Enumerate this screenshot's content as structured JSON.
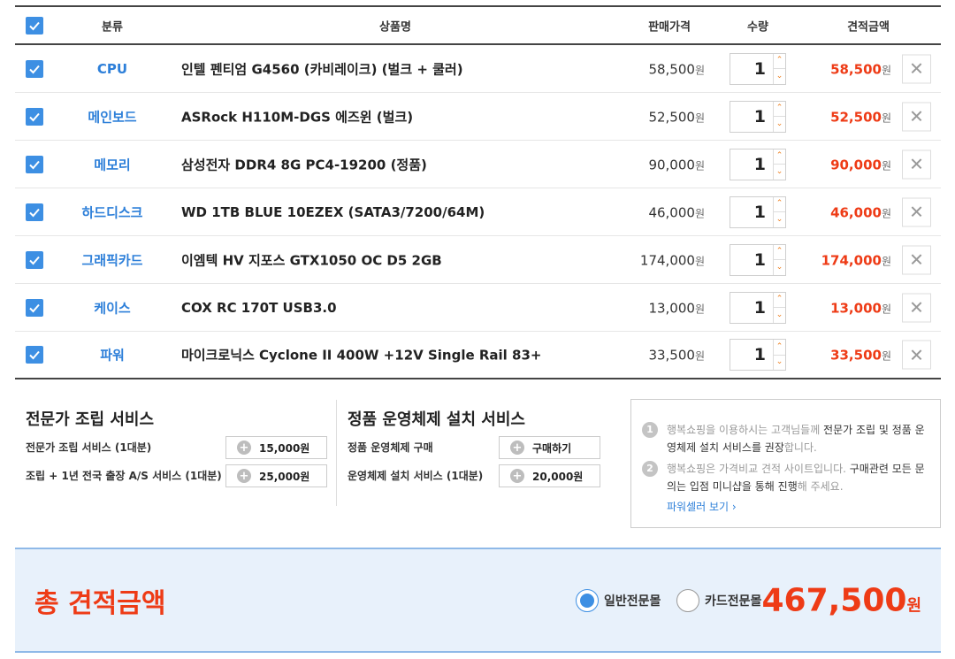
{
  "header": {
    "category": "분류",
    "product": "상품명",
    "price": "판매가격",
    "qty": "수량",
    "total": "견적금액"
  },
  "currency": "원",
  "items": [
    {
      "category": "CPU",
      "name": "인텔 펜티엄 G4560 (카비레이크) (벌크 + 쿨러)",
      "price": "58,500",
      "qty": "1",
      "total": "58,500"
    },
    {
      "category": "메인보드",
      "name": "ASRock H110M-DGS 에즈윈 (벌크)",
      "price": "52,500",
      "qty": "1",
      "total": "52,500"
    },
    {
      "category": "메모리",
      "name": "삼성전자 DDR4 8G PC4-19200 (정품)",
      "price": "90,000",
      "qty": "1",
      "total": "90,000"
    },
    {
      "category": "하드디스크",
      "name": "WD 1TB BLUE 10EZEX (SATA3/7200/64M)",
      "price": "46,000",
      "qty": "1",
      "total": "46,000"
    },
    {
      "category": "그래픽카드",
      "name": "이엠텍 HV 지포스 GTX1050 OC D5 2GB",
      "price": "174,000",
      "qty": "1",
      "total": "174,000"
    },
    {
      "category": "케이스",
      "name": "COX RC 170T USB3.0",
      "price": "13,000",
      "qty": "1",
      "total": "13,000"
    },
    {
      "category": "파워",
      "name": "마이크로닉스 Cyclone II 400W +12V Single Rail 83+",
      "price": "33,500",
      "qty": "1",
      "total": "33,500"
    }
  ],
  "assembly": {
    "title": "전문가 조립 서비스",
    "rows": [
      {
        "label": "전문가 조립 서비스 (1대분)",
        "button": "15,000원"
      },
      {
        "label": "조립 + 1년 전국 출장 A/S 서비스 (1대분)",
        "button": "25,000원"
      }
    ]
  },
  "os": {
    "title": "정품 운영체제 설치 서비스",
    "rows": [
      {
        "label": "정품 운영체제 구매",
        "button": "구매하기"
      },
      {
        "label": "운영체제 설치 서비스 (1대분)",
        "button": "20,000원"
      }
    ]
  },
  "info": {
    "item1": {
      "num": "1",
      "pre": "행복쇼핑을 이용하시는 고객님들께 ",
      "strong": "전문가 조립 및 정품 운영체제 설치 서비스를 권장",
      "post": "합니다."
    },
    "item2": {
      "num": "2",
      "pre": "행복쇼핑은 가격비교 견적 사이트입니다. ",
      "strong": "구매관련 모든 문의는 입점 미니샵을 통해 진행",
      "post": "해 주세요."
    },
    "link": "파워셀러 보기 ›"
  },
  "summary": {
    "title": "총 견적금액",
    "radio1": "일반전문몰",
    "radio2": "카드전문몰",
    "amount": "467,500",
    "unit": "원"
  },
  "colors": {
    "accent": "#3d8fe3",
    "price_red": "#ee3b16",
    "category_blue": "#2d7fd9"
  }
}
